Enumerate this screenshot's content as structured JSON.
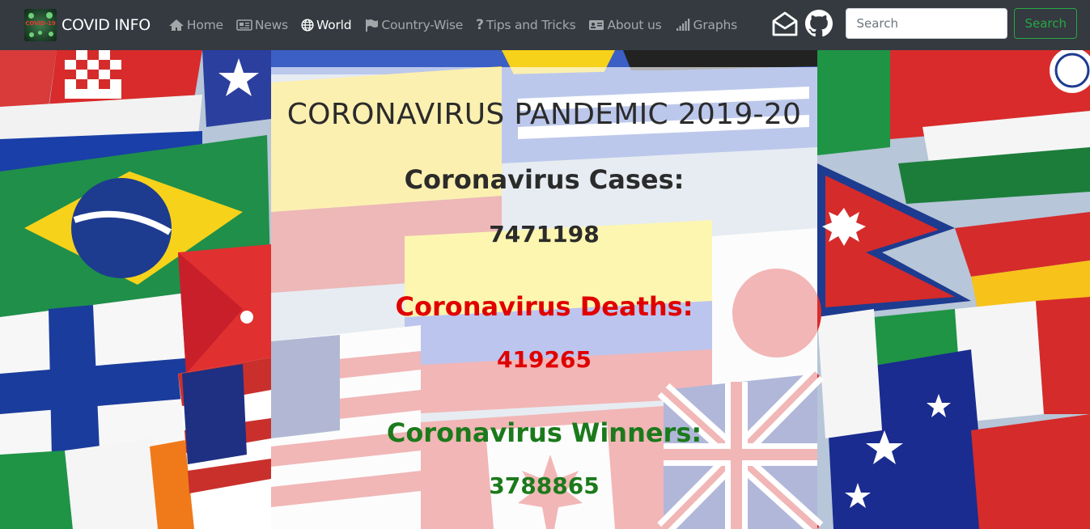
{
  "brand": {
    "name": "COVID INFO",
    "logo_text": "COVID-19"
  },
  "nav": {
    "items": [
      {
        "label": "Home",
        "icon": "home-icon",
        "active": false
      },
      {
        "label": "News",
        "icon": "newspaper-icon",
        "active": false
      },
      {
        "label": "World",
        "icon": "globe-icon",
        "active": true
      },
      {
        "label": "Country-Wise",
        "icon": "flag-icon",
        "active": false
      },
      {
        "label": "Tips and Tricks",
        "icon": "question-icon",
        "active": false
      },
      {
        "label": "About us",
        "icon": "id-card-icon",
        "active": false
      },
      {
        "label": "Graphs",
        "icon": "signal-bars-icon",
        "active": false
      }
    ]
  },
  "tools": {
    "mail_icon": "envelope-open-icon",
    "github_icon": "github-icon"
  },
  "search": {
    "placeholder": "Search",
    "button_label": "Search"
  },
  "main": {
    "title": "CORONAVIRUS PANDEMIC 2019-20",
    "cases_label": "Coronavirus Cases:",
    "cases_value": "7471198",
    "deaths_label": "Coronavirus Deaths:",
    "deaths_value": "419265",
    "winners_label": "Coronavirus Winners:",
    "winners_value": "3788865"
  },
  "colors": {
    "navbar": "#343a40",
    "deaths": "#e00000",
    "winners": "#1b7a1b",
    "search_button": "#28a745"
  }
}
